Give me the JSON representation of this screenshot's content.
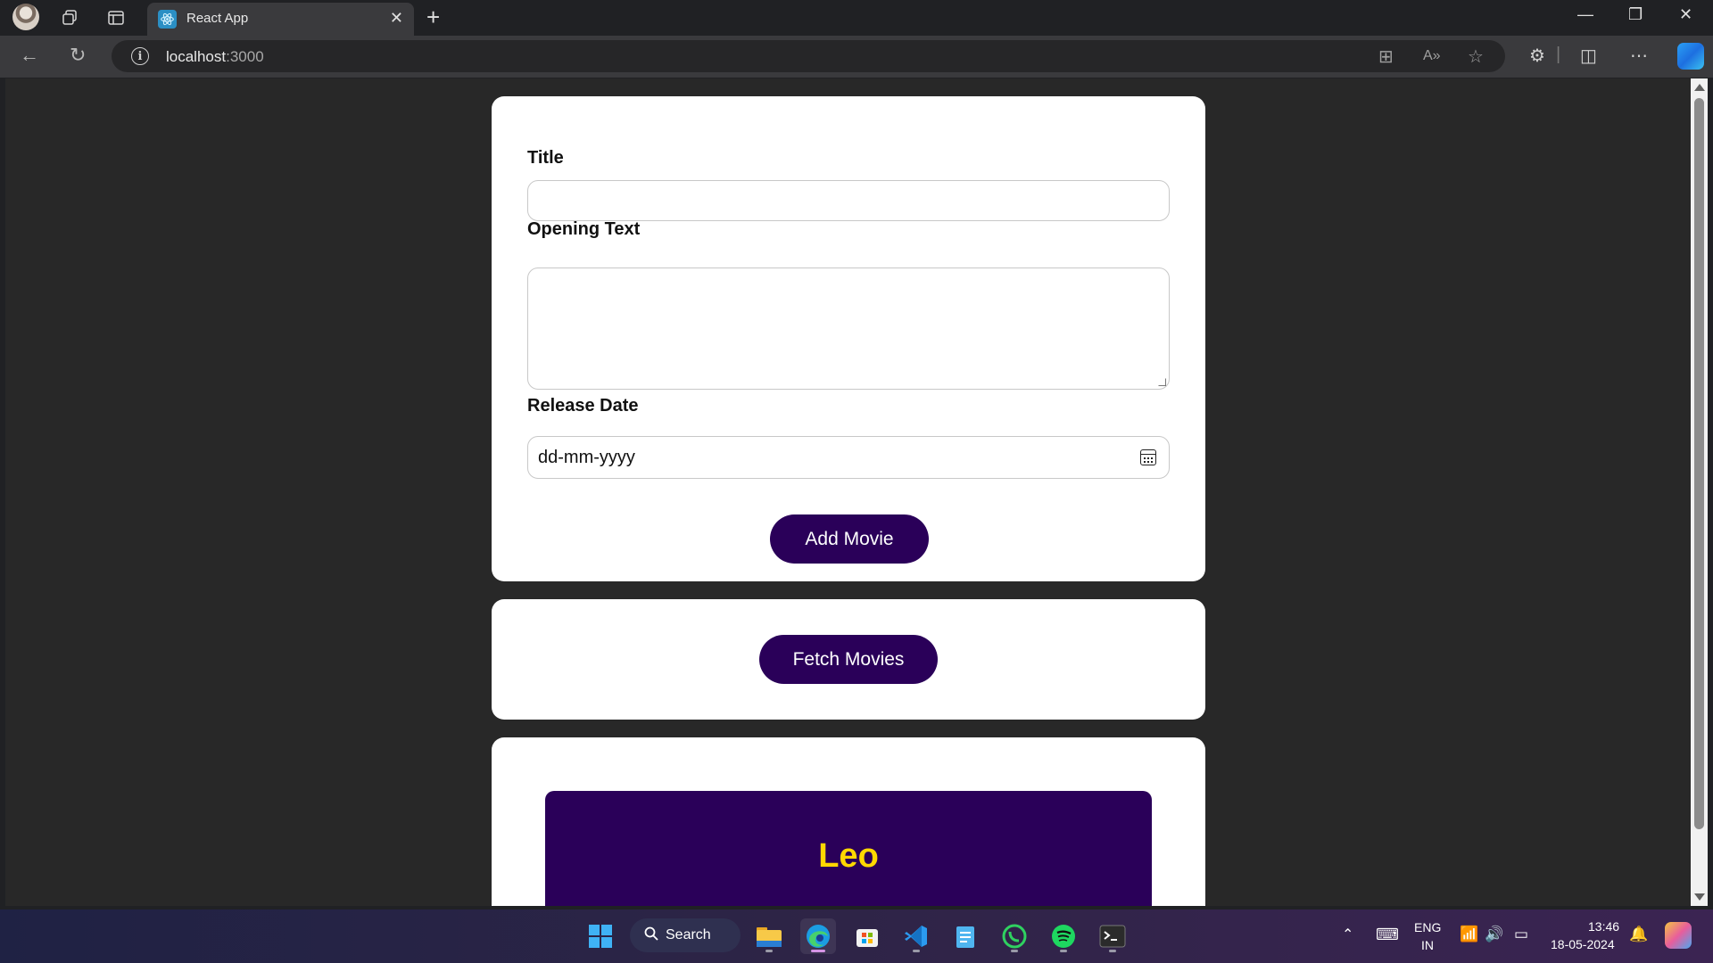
{
  "browser": {
    "tab_title": "React App",
    "url_host": "localhost",
    "url_port": ":3000"
  },
  "form": {
    "title_label": "Title",
    "title_value": "",
    "opening_text_label": "Opening Text",
    "opening_text_value": "",
    "release_date_label": "Release Date",
    "release_date_placeholder": "dd-mm-yyyy",
    "add_button": "Add Movie"
  },
  "fetch": {
    "button": "Fetch Movies"
  },
  "movies": [
    {
      "title": "Leo"
    }
  ],
  "taskbar": {
    "search_label": "Search",
    "lang_top": "ENG",
    "lang_bottom": "IN",
    "time": "13:46",
    "date": "18-05-2024"
  },
  "colors": {
    "button_bg": "#2a0059",
    "movie_title": "#ffd800",
    "page_bg": "#282828"
  }
}
